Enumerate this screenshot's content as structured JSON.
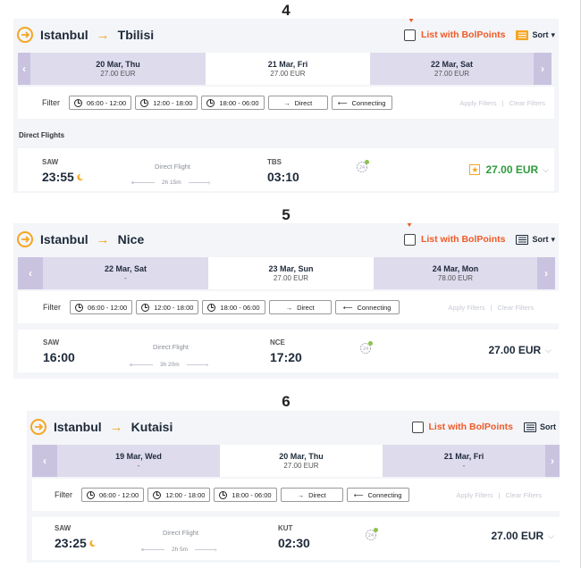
{
  "colors": {
    "accent_orange": "#f5a623",
    "bolpoints_red": "#f05a28",
    "price_green": "#2e9c3e",
    "nav_purple": "#c9c3e0",
    "date_cell": "#dedbed"
  },
  "panels": [
    {
      "step": "4",
      "origin": "Istanbul",
      "destination": "Tbilisi",
      "bolpoints_label": "List with BolPoints",
      "sort_label": "Sort",
      "dates": [
        {
          "label": "20 Mar, Thu",
          "price": "27.00 EUR"
        },
        {
          "label": "21 Mar, Fri",
          "price": "27.00 EUR"
        },
        {
          "label": "22 Mar, Sat",
          "price": "27.00 EUR"
        }
      ],
      "filter": {
        "label": "Filter",
        "buttons": [
          "06:00 - 12:00",
          "12:00 - 18:00",
          "18:00 - 06:00",
          "Direct",
          "Connecting"
        ],
        "apply": "Apply Filters",
        "clear": "Clear Filters"
      },
      "section_title": "Direct Flights",
      "flight": {
        "from_code": "SAW",
        "depart": "23:55",
        "type": "Direct Flight",
        "duration": "2h 15m",
        "to_code": "TBS",
        "arrive": "03:10",
        "bag": "24",
        "price": "27.00 EUR"
      }
    },
    {
      "step": "5",
      "origin": "Istanbul",
      "destination": "Nice",
      "bolpoints_label": "List with BolPoints",
      "sort_label": "Sort",
      "dates": [
        {
          "label": "22 Mar, Sat",
          "price": "-"
        },
        {
          "label": "23 Mar, Sun",
          "price": "27.00 EUR"
        },
        {
          "label": "24 Mar, Mon",
          "price": "78.00 EUR"
        }
      ],
      "filter": {
        "label": "Filter",
        "buttons": [
          "06:00 - 12:00",
          "12:00 - 18:00",
          "18:00 - 06:00",
          "Direct",
          "Connecting"
        ],
        "apply": "Apply Filters",
        "clear": "Clear Filters"
      },
      "flight": {
        "from_code": "SAW",
        "depart": "16:00",
        "type": "Direct Flight",
        "duration": "3h 20m",
        "to_code": "NCE",
        "arrive": "17:20",
        "bag": "24",
        "price": "27.00 EUR"
      }
    },
    {
      "step": "6",
      "origin": "Istanbul",
      "destination": "Kutaisi",
      "bolpoints_label": "List with BolPoints",
      "sort_label": "Sort",
      "dates": [
        {
          "label": "19 Mar, Wed",
          "price": "-"
        },
        {
          "label": "20 Mar, Thu",
          "price": "27.00 EUR"
        },
        {
          "label": "21 Mar, Fri",
          "price": "-"
        }
      ],
      "filter": {
        "label": "Filter",
        "buttons": [
          "06:00 - 12:00",
          "12:00 - 18:00",
          "18:00 - 06:00",
          "Direct",
          "Connecting"
        ],
        "apply": "Apply Filters",
        "clear": "Clear Filters"
      },
      "flight": {
        "from_code": "SAW",
        "depart": "23:25",
        "type": "Direct Flight",
        "duration": "2h 5m",
        "to_code": "KUT",
        "arrive": "02:30",
        "bag": "24",
        "price": "27.00 EUR"
      }
    }
  ]
}
